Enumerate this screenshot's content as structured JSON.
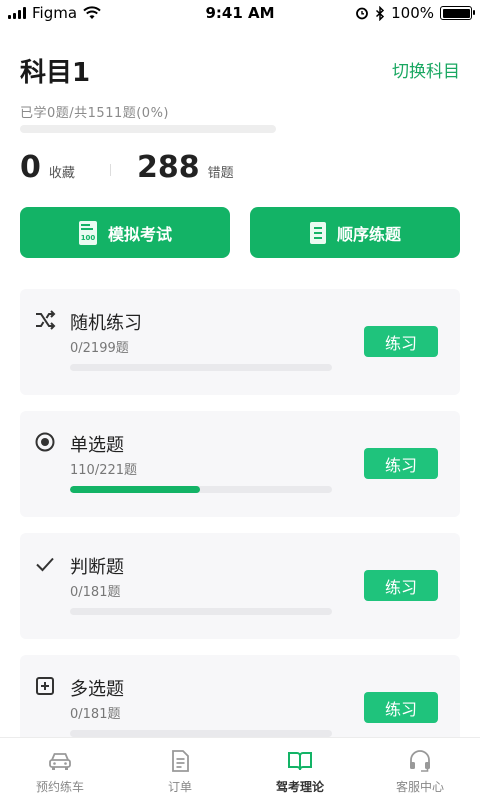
{
  "status_bar": {
    "carrier": "Figma",
    "time": "9:41 AM",
    "battery": "100%"
  },
  "header": {
    "title": "科目1",
    "switch_label": "切换科目"
  },
  "progress": {
    "text": "已学0题/共1511题(0%)",
    "fraction": 0
  },
  "stats": {
    "favorites_count": "0",
    "favorites_label": "收藏",
    "wrong_count": "288",
    "wrong_label": "错题"
  },
  "actions": {
    "exam_label": "模拟考试",
    "exam_icon": "exam-100-icon",
    "order_label": "顺序练题",
    "order_icon": "document-list-icon"
  },
  "practice_items": [
    {
      "title": "随机练习",
      "count": "0/2199题",
      "progress": 0,
      "button": "练习",
      "icon": "shuffle-icon"
    },
    {
      "title": "单选题",
      "count": "110/221题",
      "progress": 0.4977,
      "button": "练习",
      "icon": "radio-target-icon"
    },
    {
      "title": "判断题",
      "count": "0/181题",
      "progress": 0,
      "button": "练习",
      "icon": "check-icon"
    },
    {
      "title": "多选题",
      "count": "0/181题",
      "progress": 0,
      "button": "练习",
      "icon": "plus-square-icon"
    }
  ],
  "tabbar": {
    "tabs": [
      {
        "label": "预约练车",
        "icon": "car-icon",
        "active": false
      },
      {
        "label": "订单",
        "icon": "order-doc-icon",
        "active": false
      },
      {
        "label": "驾考理论",
        "icon": "open-book-icon",
        "active": true
      },
      {
        "label": "客服中心",
        "icon": "headset-icon",
        "active": false
      }
    ]
  },
  "colors": {
    "accent": "#13b366",
    "practice_button": "#1fc37c",
    "link": "#19a761"
  }
}
